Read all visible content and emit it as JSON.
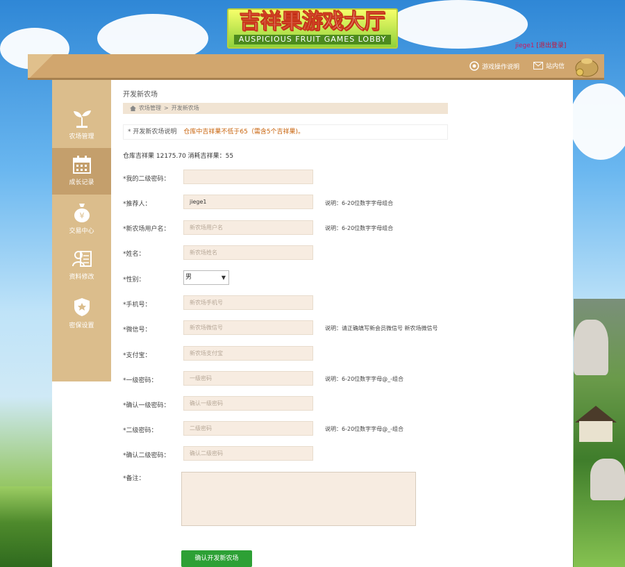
{
  "header": {
    "logo_cn": "吉祥果游戏大厅",
    "logo_en": "AUSPICIOUS FRUIT GAMES LOBBY",
    "username": "jiege1",
    "logout": "[退出登录]"
  },
  "topbar": {
    "items": [
      {
        "label": "游戏操作说明",
        "icon": "play-circle-icon"
      },
      {
        "label": "站内信",
        "icon": "mail-icon"
      }
    ]
  },
  "sidebar": {
    "items": [
      {
        "label": "农场管理",
        "icon": "sprout-icon",
        "active": false
      },
      {
        "label": "成长记录",
        "icon": "calendar-icon",
        "active": true
      },
      {
        "label": "交易中心",
        "icon": "money-bag-icon",
        "active": false
      },
      {
        "label": "资料修改",
        "icon": "profile-card-icon",
        "active": false
      },
      {
        "label": "密保设置",
        "icon": "shield-icon",
        "active": false
      }
    ]
  },
  "page": {
    "title": "开发新农场",
    "breadcrumb": [
      "农场管理",
      "开发新农场"
    ],
    "notice_label": "* 开发新农场说明",
    "notice_text": "仓库中吉祥果不低于65（需含5个吉祥果)。",
    "stock_text": "仓库吉祥果 12175.70 消耗吉祥果：55"
  },
  "form": {
    "fields": [
      {
        "label": "*我的二级密码：",
        "value": "",
        "placeholder": "",
        "note": ""
      },
      {
        "label": "*推荐人：",
        "value": "jiege1",
        "placeholder": "",
        "note": "说明：6-20位数字字母组合"
      },
      {
        "label": "*新农场用户名：",
        "value": "",
        "placeholder": "新农场用户名",
        "note": "说明：6-20位数字字母组合"
      },
      {
        "label": "*姓名：",
        "value": "",
        "placeholder": "新农场姓名",
        "note": ""
      },
      {
        "label": "*性别：",
        "select_value": "男"
      },
      {
        "label": "*手机号：",
        "value": "",
        "placeholder": "新农场手机号",
        "note": ""
      },
      {
        "label": "*微信号：",
        "value": "",
        "placeholder": "新农场微信号",
        "note": "说明：请正确填写新会员微信号 新农场微信号"
      },
      {
        "label": "*支付宝：",
        "value": "",
        "placeholder": "新农场支付宝",
        "note": ""
      },
      {
        "label": "*一级密码：",
        "value": "",
        "placeholder": "一级密码",
        "note": "说明：6-20位数字字母@_-组合"
      },
      {
        "label": "*确认一级密码：",
        "value": "",
        "placeholder": "确认一级密码",
        "note": ""
      },
      {
        "label": "*二级密码：",
        "value": "",
        "placeholder": "二级密码",
        "note": "说明：6-20位数字字母@_-组合"
      },
      {
        "label": "*确认二级密码：",
        "value": "",
        "placeholder": "确认二级密码",
        "note": ""
      },
      {
        "label": "*备注："
      }
    ],
    "submit_label": "确认开发新农场"
  },
  "colors": {
    "accent": "#d1a66e",
    "sidebar_bg": "#dbbd8c",
    "sidebar_active": "#c49f6c",
    "submit": "#2da035",
    "field_bg": "#f7ece1",
    "notice_text": "#c8620a"
  }
}
